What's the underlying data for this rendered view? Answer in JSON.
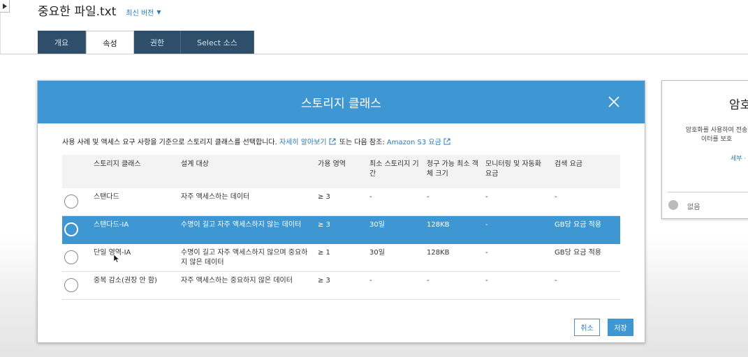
{
  "header": {
    "file_title": "중요한 파일.txt",
    "version_label": "최신 버전"
  },
  "tabs": [
    {
      "label": "개요",
      "active": false
    },
    {
      "label": "속성",
      "active": true
    },
    {
      "label": "권한",
      "active": false
    },
    {
      "label": "Select 소스",
      "active": false
    }
  ],
  "modal": {
    "title": "스토리지 클래스",
    "description_prefix": "사용 사례 및 액세스 요구 사항을 기준으로 스토리지 클래스를 선택합니다.",
    "learn_more_link": "자세히 알아보기",
    "description_mid": "또는 다음 참조:",
    "pricing_link": "Amazon S3 요금",
    "columns": {
      "storage_class": "스토리지 클래스",
      "designed_for": "설계 대상",
      "availability_zones": "가용 영역",
      "min_storage_line1": "최소 스토리지 기",
      "min_storage_line2": "간",
      "min_object_line1": "청구 가능 최소 객",
      "min_object_line2": "체 크기",
      "monitoring_line1": "모니터링 및 자동화",
      "monitoring_line2": "요금",
      "retrieval": "검색 요금"
    },
    "rows": [
      {
        "storage_class": "스탠다드",
        "designed_for_line1": "자주 액세스하는 데이터",
        "designed_for_line2": "",
        "az": "≥ 3",
        "min_storage": "-",
        "min_object": "-",
        "monitoring": "-",
        "retrieval": "-",
        "selected": false
      },
      {
        "storage_class": "스탠다드-IA",
        "designed_for_line1": "수명이 길고 자주 액세스하지 않는 데이터",
        "designed_for_line2": "",
        "az": "≥ 3",
        "min_storage": "30일",
        "min_object": "128KB",
        "monitoring": "-",
        "retrieval": "GB당 요금 적용",
        "selected": true
      },
      {
        "storage_class": "단일 영역-IA",
        "designed_for_line1": "수명이 길고 자주 액세스하지 않으며 중요하",
        "designed_for_line2": "지 않은 데이터",
        "az": "≥ 1",
        "min_storage": "30일",
        "min_object": "128KB",
        "monitoring": "-",
        "retrieval": "GB당 요금 적용",
        "selected": false
      },
      {
        "storage_class": "중복 감소(권장 안 함)",
        "designed_for_line1": "자주 액세스하는 중요하지 않은 데이터",
        "designed_for_line2": "",
        "az": "≥ 3",
        "min_storage": "-",
        "min_object": "-",
        "monitoring": "-",
        "retrieval": "-",
        "selected": false
      }
    ],
    "cancel_label": "취소",
    "save_label": "저장"
  },
  "side_panel": {
    "title": "암호",
    "desc_line1": "암호화를 사용하여 전송",
    "desc_line2": "이터를 보호",
    "link": "세부 ·",
    "option_none": "없음"
  },
  "colors": {
    "accent": "#3e96d2",
    "tab_dark": "#2e4e69",
    "link": "#2a7ab8"
  }
}
